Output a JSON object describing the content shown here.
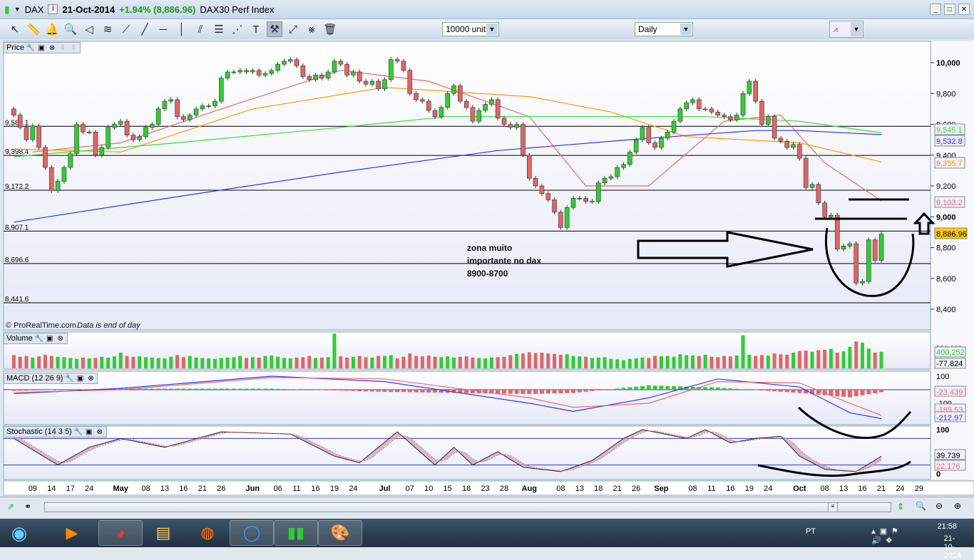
{
  "title": {
    "symbol": "DAX",
    "date": "21-Oct-2014",
    "change": "+1.94% (8,886.96)",
    "name": "DAX30 Perf Index"
  },
  "toolbar": {
    "tools": [
      "pointer-icon",
      "ruler-icon",
      "alarm-bell-icon",
      "zoom-magnifier-icon",
      "fan-triangle-icon",
      "channel-icon",
      "segment-icon",
      "line-icon",
      "horizontal-line-icon",
      "vertical-line-icon",
      "parallel-lines-icon",
      "fibonacci-icon",
      "regression-channel-icon",
      "text-icon",
      "tools-icon",
      "point-segment-icon",
      "crossed-line-icon",
      "trash-icon"
    ],
    "quantity": "10000 units",
    "period": "Daily"
  },
  "panels": {
    "price": "Price",
    "volume": "Volume",
    "macd": "MACD (12 26 9)",
    "stochastic": "Stochastic (14 3 5)"
  },
  "watermark": "© ProRealTime.com",
  "watermark_note": "Data is end of day",
  "annotation": {
    "line1": "zona muito",
    "line2": "importante no dax",
    "line3": "8900-8700"
  },
  "scrollbar": {
    "thumb": "≡"
  },
  "taskbar": {
    "language": "PT",
    "time": "21:58",
    "date": "21-10-2014"
  },
  "chart_data": {
    "type": "candlestick",
    "colors": {
      "up": "#33cc33",
      "down": "#e06666",
      "ma20": "#e86a6a",
      "ma50": "#ff9900",
      "ma100": "#33dd33",
      "ma200": "#3333ee",
      "last": "#ffcc00"
    },
    "price_axis": {
      "ylim": [
        8260,
        10140
      ],
      "ticks": [
        "10,000",
        "9,800",
        "9,600",
        "9,400",
        "9,200",
        "9,000",
        "8,800",
        "8,600",
        "8,400"
      ]
    },
    "closes": [
      9660,
      9580,
      9500,
      9590,
      9450,
      9320,
      9170,
      9230,
      9320,
      9410,
      9600,
      9550,
      9550,
      9400,
      9450,
      9580,
      9600,
      9620,
      9530,
      9500,
      9520,
      9580,
      9600,
      9700,
      9750,
      9760,
      9650,
      9630,
      9660,
      9700,
      9720,
      9720,
      9750,
      9900,
      9940,
      9940,
      9950,
      9940,
      9950,
      9920,
      9930,
      9950,
      9990,
      10010,
      10020,
      9980,
      9910,
      9890,
      9920,
      9900,
      9940,
      10010,
      9990,
      9920,
      9940,
      9880,
      9860,
      9880,
      9830,
      9890,
      10020,
      10010,
      9950,
      9800,
      9760,
      9750,
      9690,
      9650,
      9710,
      9800,
      9850,
      9750,
      9710,
      9620,
      9690,
      9730,
      9760,
      9640,
      9600,
      9580,
      9600,
      9400,
      9250,
      9200,
      9150,
      9110,
      9030,
      8930,
      9060,
      9120,
      9120,
      9100,
      9100,
      9220,
      9250,
      9260,
      9320,
      9340,
      9420,
      9500,
      9580,
      9480,
      9450,
      9510,
      9550,
      9620,
      9700,
      9740,
      9760,
      9700,
      9700,
      9680,
      9660,
      9650,
      9630,
      9660,
      9800,
      9880,
      9750,
      9600,
      9650,
      9510,
      9490,
      9450,
      9470,
      9380,
      9190,
      9210,
      9090,
      9000,
      9010,
      8790,
      8810,
      8825,
      8570,
      8580,
      8850,
      8717,
      8887
    ],
    "volume": [
      320,
      280,
      300,
      260,
      290,
      330,
      300,
      280,
      270,
      250,
      230,
      260,
      240,
      250,
      280,
      260,
      290,
      380,
      300,
      280,
      290,
      270,
      260,
      250,
      240,
      280,
      320,
      270,
      300,
      260,
      250,
      240,
      230,
      250,
      260,
      270,
      300,
      250,
      270,
      260,
      300,
      310,
      280,
      250,
      240,
      260,
      270,
      300,
      250,
      260,
      270,
      840,
      290,
      260,
      280,
      300,
      270,
      260,
      300,
      300,
      320,
      240,
      280,
      360,
      300,
      290,
      310,
      280,
      270,
      290,
      260,
      280,
      290,
      260,
      250,
      240,
      260,
      270,
      280,
      320,
      350,
      360,
      390,
      370,
      380,
      360,
      350,
      330,
      340,
      300,
      290,
      280,
      250,
      260,
      270,
      230,
      220,
      200,
      230,
      240,
      260,
      250,
      300,
      290,
      300,
      280,
      340,
      320,
      310,
      300,
      330,
      280,
      270,
      300,
      290,
      310,
      800,
      330,
      300,
      320,
      310,
      360,
      340,
      330,
      380,
      420,
      430,
      400,
      440,
      450,
      470,
      380,
      410,
      520,
      650,
      620,
      480,
      380,
      400
    ],
    "moving_averages": {
      "ma20": [
        [
          "2014-04-09",
          9420
        ],
        [
          "2014-05-02",
          9480
        ],
        [
          "2014-05-26",
          9700
        ],
        [
          "2014-06-20",
          9950
        ],
        [
          "2014-07-10",
          9880
        ],
        [
          "2014-08-01",
          9650
        ],
        [
          "2014-08-14",
          9200
        ],
        [
          "2014-08-28",
          9200
        ],
        [
          "2014-09-15",
          9620
        ],
        [
          "2014-09-26",
          9660
        ],
        [
          "2014-10-08",
          9350
        ],
        [
          "2014-10-21",
          9103.2
        ]
      ],
      "ma50": [
        [
          "2014-04-04",
          9440
        ],
        [
          "2014-05-02",
          9420
        ],
        [
          "2014-06-02",
          9700
        ],
        [
          "2014-07-01",
          9840
        ],
        [
          "2014-08-01",
          9780
        ],
        [
          "2014-08-20",
          9680
        ],
        [
          "2014-09-05",
          9520
        ],
        [
          "2014-10-01",
          9480
        ],
        [
          "2014-10-21",
          9355.7
        ]
      ],
      "ma100": [
        [
          "2014-04-04",
          9390
        ],
        [
          "2014-05-15",
          9480
        ],
        [
          "2014-06-20",
          9580
        ],
        [
          "2014-07-15",
          9650
        ],
        [
          "2014-08-15",
          9650
        ],
        [
          "2014-09-10",
          9650
        ],
        [
          "2014-10-01",
          9620
        ],
        [
          "2014-10-21",
          9545.1
        ]
      ],
      "ma200": [
        [
          "2014-04-04",
          8965
        ],
        [
          "2014-05-15",
          9130
        ],
        [
          "2014-06-20",
          9290
        ],
        [
          "2014-07-25",
          9430
        ],
        [
          "2014-08-25",
          9500
        ],
        [
          "2014-09-20",
          9560
        ],
        [
          "2014-10-01",
          9560
        ],
        [
          "2014-10-21",
          9532.8
        ]
      ]
    },
    "levels": [
      "9,587.1",
      "9,398.4",
      "9,172.2",
      "8,907.1",
      "8,696.6",
      "8,441.6"
    ],
    "last_labels": {
      "ma100": "9,545.1",
      "ma200": "9,532.8",
      "ma50": "9,355.7",
      "ma20": "9,103.2",
      "price": "8,886.96"
    },
    "x_ticks": [
      [
        "09",
        "2014-04-09"
      ],
      [
        "14",
        "2014-04-14"
      ],
      [
        "17",
        "2014-04-17"
      ],
      [
        "24",
        "2014-04-24"
      ],
      [
        "May",
        "2014-05-02"
      ],
      [
        "08",
        "2014-05-08"
      ],
      [
        "13",
        "2014-05-13"
      ],
      [
        "16",
        "2014-05-16"
      ],
      [
        "21",
        "2014-05-21"
      ],
      [
        "26",
        "2014-05-26"
      ],
      [
        "Jun",
        "2014-06-02"
      ],
      [
        "06",
        "2014-06-06"
      ],
      [
        "11",
        "2014-06-11"
      ],
      [
        "16",
        "2014-06-16"
      ],
      [
        "19",
        "2014-06-19"
      ],
      [
        "24",
        "2014-06-24"
      ],
      [
        "Jul",
        "2014-07-01"
      ],
      [
        "07",
        "2014-07-07"
      ],
      [
        "10",
        "2014-07-10"
      ],
      [
        "15",
        "2014-07-15"
      ],
      [
        "18",
        "2014-07-18"
      ],
      [
        "23",
        "2014-07-23"
      ],
      [
        "28",
        "2014-07-28"
      ],
      [
        "Aug",
        "2014-08-01"
      ],
      [
        "08",
        "2014-08-08"
      ],
      [
        "13",
        "2014-08-13"
      ],
      [
        "18",
        "2014-08-18"
      ],
      [
        "21",
        "2014-08-21"
      ],
      [
        "26",
        "2014-08-26"
      ],
      [
        "Sep",
        "2014-09-01"
      ],
      [
        "08",
        "2014-09-08"
      ],
      [
        "11",
        "2014-09-11"
      ],
      [
        "16",
        "2014-09-16"
      ],
      [
        "19",
        "2014-09-19"
      ],
      [
        "24",
        "2014-09-24"
      ],
      [
        "Oct",
        "2014-10-01"
      ],
      [
        "08",
        "2014-10-08"
      ],
      [
        "13",
        "2014-10-13"
      ],
      [
        "16",
        "2014-10-16"
      ],
      [
        "21",
        "2014-10-21"
      ],
      [
        "24",
        "2014-10-24"
      ],
      [
        "29",
        "2014-10-29"
      ]
    ],
    "volume_axis": {
      "top": "500,000",
      "labels": [
        "400,252",
        "-77.824"
      ]
    },
    "macd": {
      "ticks": [
        "100",
        "0",
        "-100"
      ],
      "labels": [
        "-23.439",
        "-189.53",
        "-212.97"
      ],
      "macd": [
        [
          "2014-04-04",
          -30
        ],
        [
          "2014-05-02",
          10
        ],
        [
          "2014-06-05",
          100
        ],
        [
          "2014-07-01",
          60
        ],
        [
          "2014-08-01",
          -100
        ],
        [
          "2014-08-12",
          -160
        ],
        [
          "2014-08-28",
          -60
        ],
        [
          "2014-09-12",
          80
        ],
        [
          "2014-10-01",
          20
        ],
        [
          "2014-10-14",
          -170
        ],
        [
          "2014-10-21",
          -213
        ]
      ],
      "signal": [
        [
          "2014-04-04",
          -20
        ],
        [
          "2014-05-02",
          0
        ],
        [
          "2014-06-05",
          90
        ],
        [
          "2014-07-01",
          80
        ],
        [
          "2014-08-01",
          -60
        ],
        [
          "2014-08-12",
          -130
        ],
        [
          "2014-08-28",
          -100
        ],
        [
          "2014-09-12",
          60
        ],
        [
          "2014-10-01",
          50
        ],
        [
          "2014-10-14",
          -100
        ],
        [
          "2014-10-21",
          -190
        ]
      ]
    },
    "stochastic": {
      "ticks": [
        "100",
        "50",
        "0"
      ],
      "labels": [
        "39.739",
        "22.176"
      ],
      "bands": [
        80,
        20
      ],
      "k": [
        [
          "2014-04-04",
          80
        ],
        [
          "2014-04-15",
          20
        ],
        [
          "2014-04-24",
          60
        ],
        [
          "2014-05-02",
          80
        ],
        [
          "2014-05-13",
          60
        ],
        [
          "2014-05-26",
          95
        ],
        [
          "2014-06-10",
          90
        ],
        [
          "2014-06-19",
          40
        ],
        [
          "2014-06-25",
          25
        ],
        [
          "2014-07-03",
          95
        ],
        [
          "2014-07-11",
          20
        ],
        [
          "2014-07-16",
          60
        ],
        [
          "2014-07-21",
          20
        ],
        [
          "2014-07-25",
          50
        ],
        [
          "2014-07-31",
          15
        ],
        [
          "2014-08-08",
          5
        ],
        [
          "2014-08-15",
          30
        ],
        [
          "2014-08-22",
          80
        ],
        [
          "2014-08-27",
          100
        ],
        [
          "2014-09-05",
          80
        ],
        [
          "2014-09-10",
          100
        ],
        [
          "2014-09-16",
          70
        ],
        [
          "2014-09-22",
          80
        ],
        [
          "2014-09-26",
          85
        ],
        [
          "2014-10-01",
          40
        ],
        [
          "2014-10-08",
          10
        ],
        [
          "2014-10-15",
          5
        ],
        [
          "2014-10-21",
          39.7
        ]
      ]
    }
  }
}
